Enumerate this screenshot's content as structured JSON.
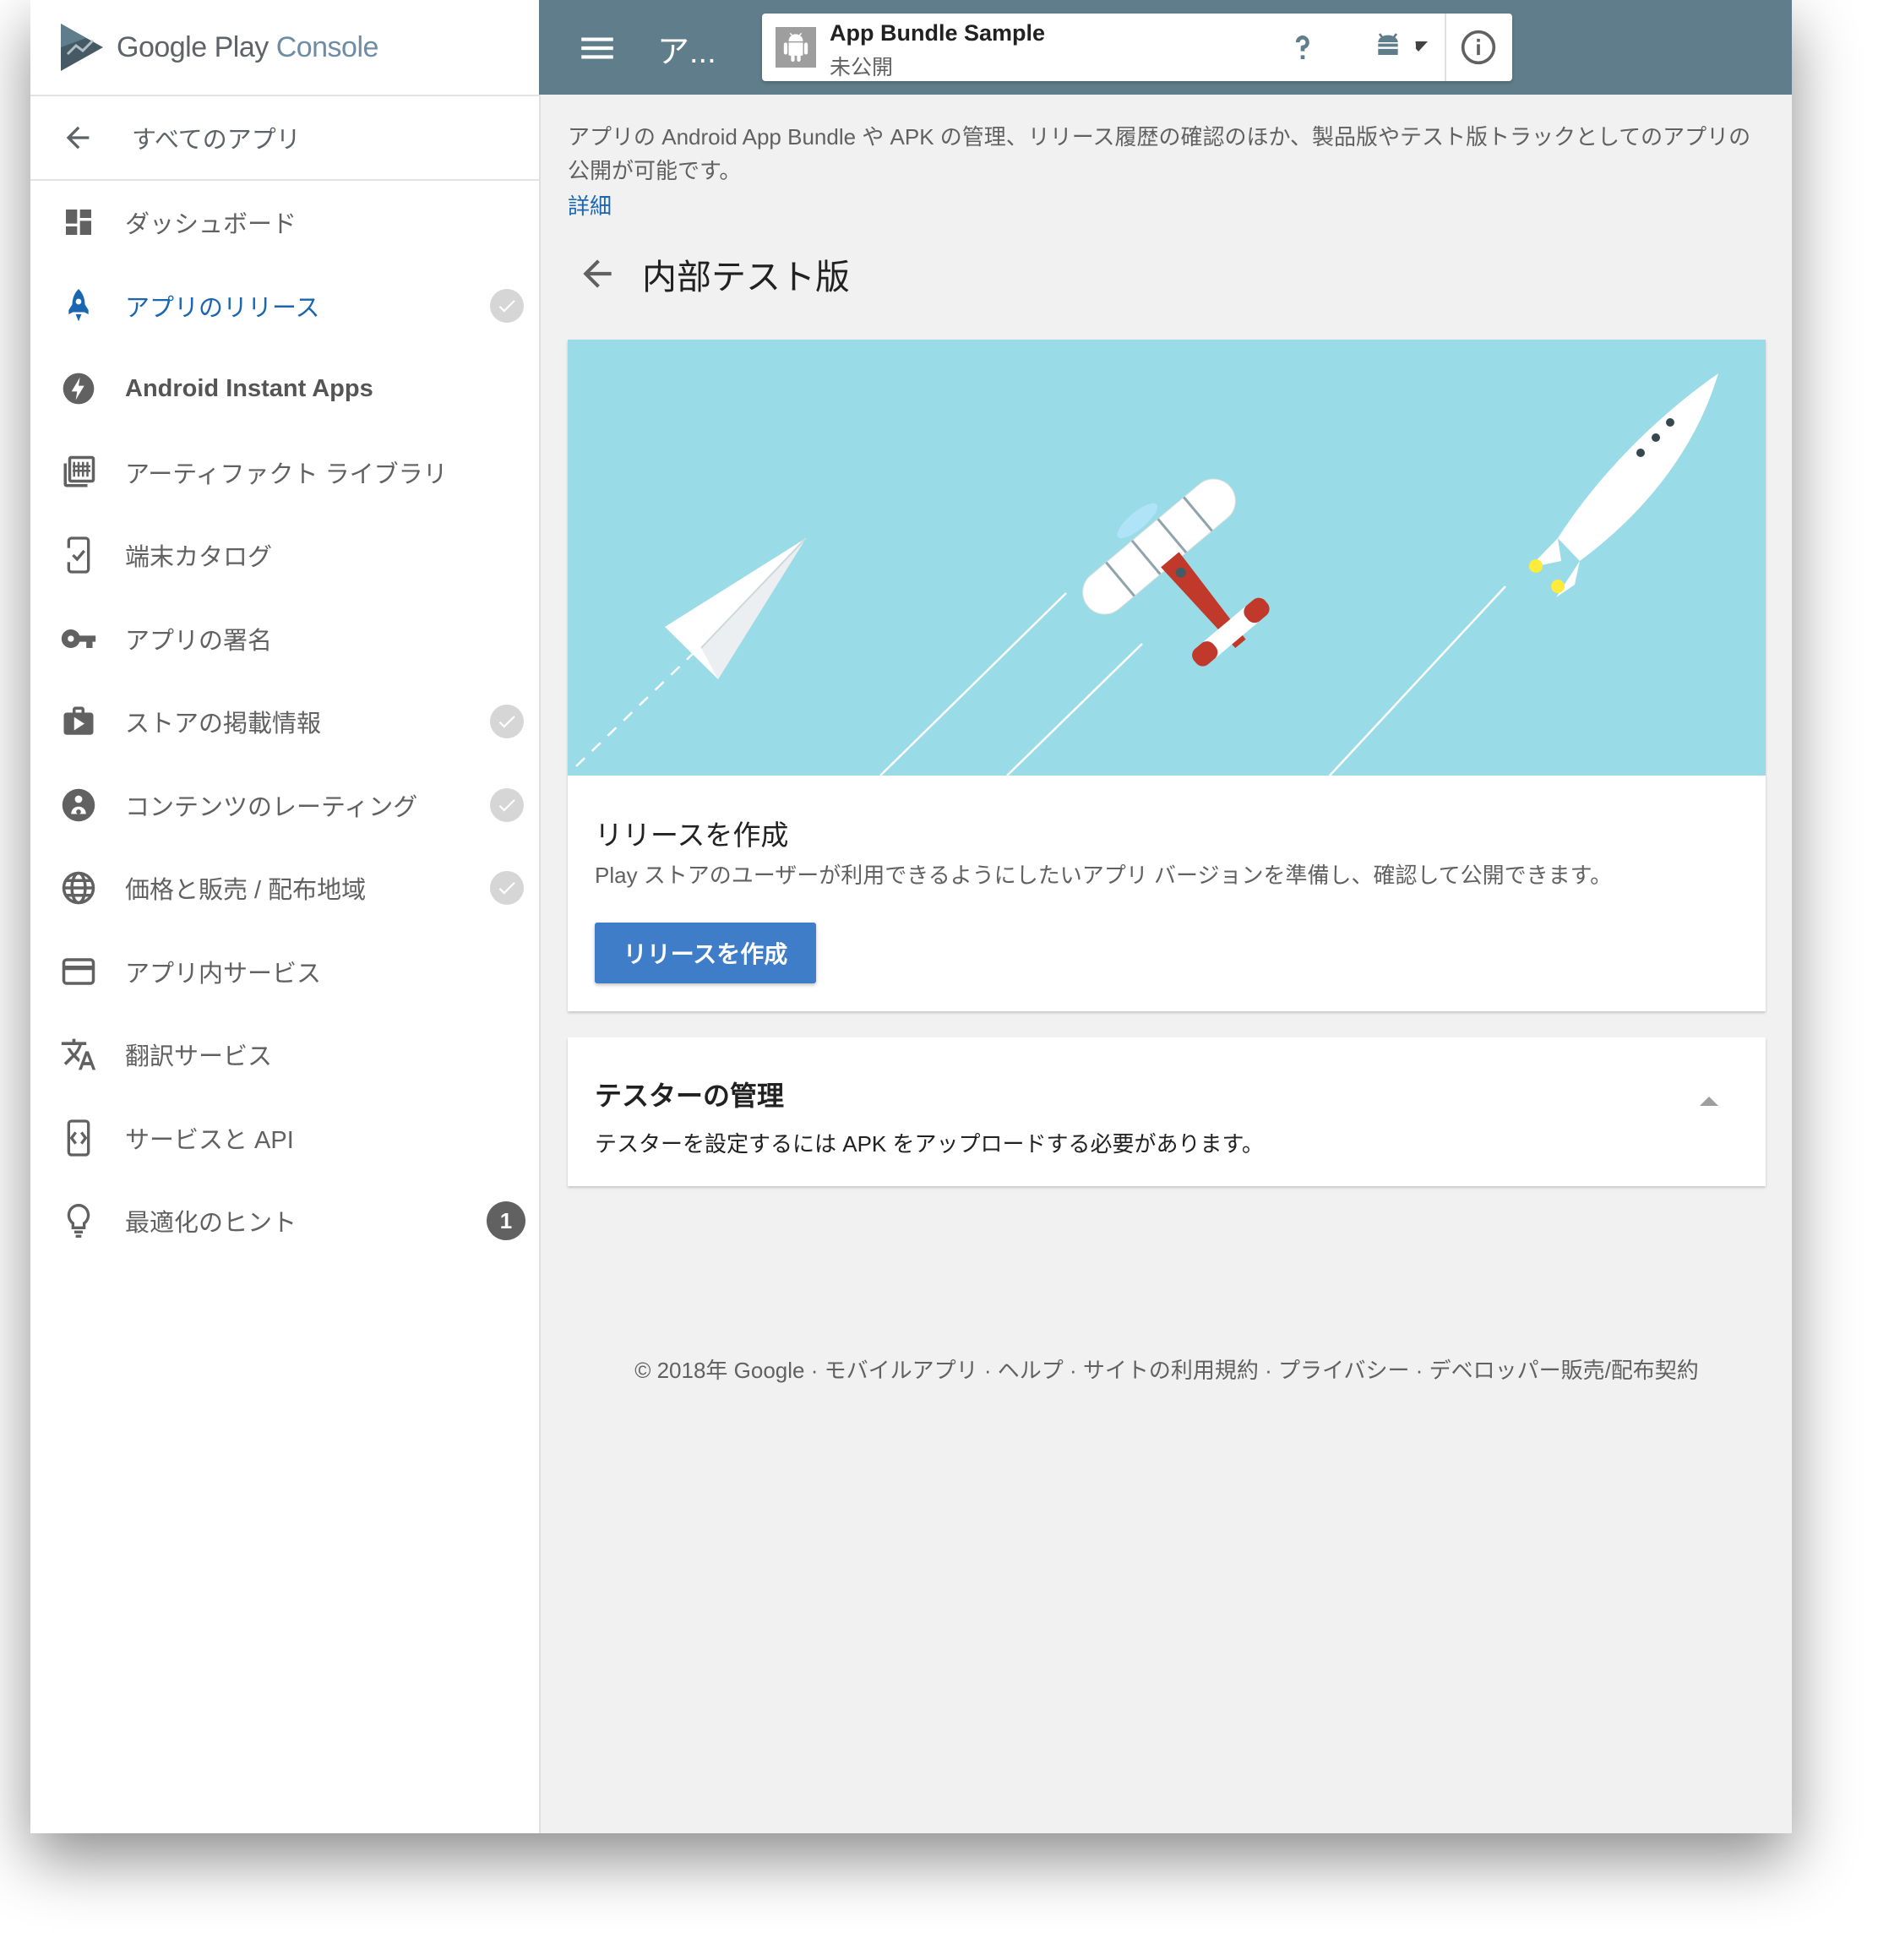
{
  "brand": {
    "name_main": "Google Play",
    "name_accent": "Console"
  },
  "sidebar": {
    "back_label": "すべてのアプリ",
    "items": [
      {
        "label": "ダッシュボード",
        "icon": "dashboard-icon"
      },
      {
        "label": "アプリのリリース",
        "icon": "rocket-icon",
        "active": true,
        "check": true
      },
      {
        "label": "Android Instant Apps",
        "icon": "lightning-icon"
      },
      {
        "label": "アーティファクト ライブラリ",
        "icon": "library-icon"
      },
      {
        "label": "端末カタログ",
        "icon": "device-check-icon"
      },
      {
        "label": "アプリの署名",
        "icon": "key-icon"
      },
      {
        "label": "ストアの掲載情報",
        "icon": "store-bag-icon",
        "check": true
      },
      {
        "label": "コンテンツのレーティング",
        "icon": "rating-icon",
        "check": true
      },
      {
        "label": "価格と販売 / 配布地域",
        "icon": "globe-icon",
        "check": true
      },
      {
        "label": "アプリ内サービス",
        "icon": "credit-card-icon"
      },
      {
        "label": "翻訳サービス",
        "icon": "translate-icon"
      },
      {
        "label": "サービスと API",
        "icon": "api-icon"
      },
      {
        "label": "最適化のヒント",
        "icon": "lightbulb-icon",
        "badge": "1"
      }
    ]
  },
  "topbar": {
    "app_short": "ア...",
    "app_name": "App Bundle Sample",
    "app_status": "未公開",
    "color": "#607d8b"
  },
  "main": {
    "intro": "アプリの Android App Bundle や APK の管理、リリース履歴の確認のほか、製品版やテスト版トラックとしてのアプリの公開が可能です。",
    "more_link": "詳細",
    "heading": "内部テスト版",
    "release_card": {
      "title": "リリースを作成",
      "description": "Play ストアのユーザーが利用できるようにしたいアプリ バージョンを準備し、確認して公開できます。",
      "button": "リリースを作成"
    },
    "testers_card": {
      "title": "テスターの管理",
      "description": "テスターを設定するには APK をアップロードする必要があります。"
    }
  },
  "footer": {
    "copyright": "© 2018年 Google",
    "links": [
      "モバイルアプリ",
      "ヘルプ",
      "サイトの利用規約",
      "プライバシー",
      "デベロッパー販売/配布契約"
    ],
    "separator": " · "
  },
  "colors": {
    "accent_blue": "#1a66b0",
    "button_blue": "#3f7dc9",
    "hero_bg": "#99dbe7"
  }
}
